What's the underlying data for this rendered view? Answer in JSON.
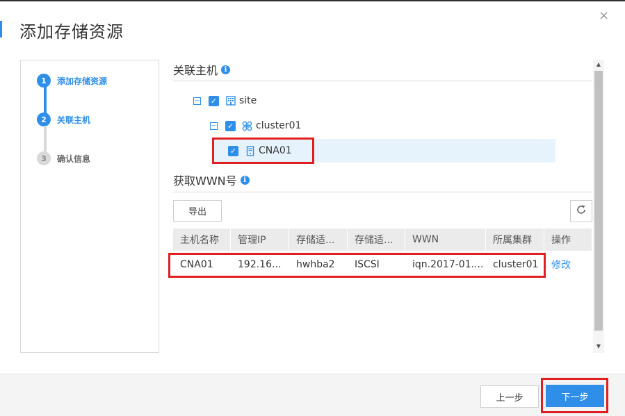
{
  "dialog": {
    "title": "添加存储资源",
    "close_glyph": "×"
  },
  "steps": [
    {
      "number": "1",
      "label": "添加存储资源",
      "state": "completed"
    },
    {
      "number": "2",
      "label": "关联主机",
      "state": "active"
    },
    {
      "number": "3",
      "label": "确认信息",
      "state": "pending"
    }
  ],
  "associate_hosts": {
    "title": "关联主机",
    "tree": {
      "site": {
        "label": "site",
        "checked": true,
        "expanded": true,
        "icon": "building-icon"
      },
      "cluster": {
        "label": "cluster01",
        "checked": true,
        "expanded": true,
        "icon": "cluster-icon"
      },
      "host": {
        "label": "CNA01",
        "checked": true,
        "selected": true,
        "icon": "server-icon"
      }
    }
  },
  "wwn": {
    "title": "获取WWN号",
    "export_label": "导出",
    "refresh_icon": "refresh-icon",
    "columns": [
      "主机名称",
      "管理IP",
      "存储适...",
      "存储适...",
      "WWN",
      "所属集群",
      "操作"
    ],
    "rows": [
      {
        "host": "CNA01",
        "ip": "192.16...",
        "adapter": "hwhba2",
        "adapter_type": "ISCSI",
        "wwn": "iqn.2017-01....",
        "cluster": "cluster01",
        "action": "修改"
      }
    ]
  },
  "footer": {
    "prev_label": "上一步",
    "next_label": "下一步"
  },
  "colors": {
    "accent": "#2f8fe8",
    "highlight": "#e02020",
    "selected_row": "#e6f2fc"
  }
}
